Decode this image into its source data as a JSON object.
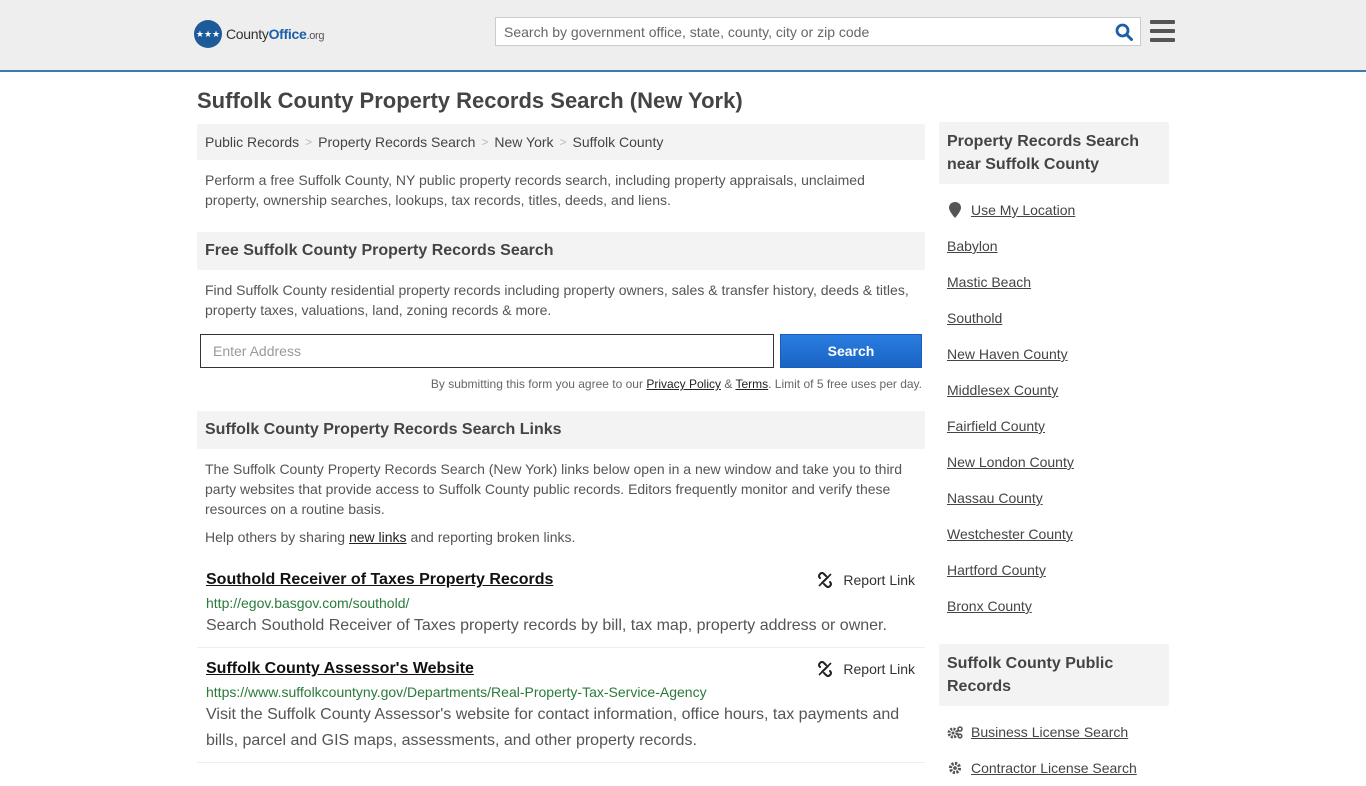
{
  "header": {
    "logo": {
      "name_part1": "County",
      "name_part2": "Office",
      "suffix": ".org"
    },
    "search_placeholder": "Search by government office, state, county, city or zip code",
    "brand_color": "#1d5a9a",
    "accent_border": "#3a7bb0"
  },
  "page_title": "Suffolk County Property Records Search (New York)",
  "breadcrumb": [
    {
      "label": "Public Records"
    },
    {
      "label": "Property Records Search"
    },
    {
      "label": "New York"
    },
    {
      "label": "Suffolk County"
    }
  ],
  "intro": "Perform a free Suffolk County, NY public property records search, including property appraisals, unclaimed property, ownership searches, lookups, tax records, titles, deeds, and liens.",
  "free_search": {
    "heading": "Free Suffolk County Property Records Search",
    "text": "Find Suffolk County residential property records including property owners, sales & transfer history, deeds & titles, property taxes, valuations, land, zoning records & more.",
    "input_placeholder": "Enter Address",
    "button_label": "Search",
    "disclaimer_pre": "By submitting this form you agree to our ",
    "privacy_label": "Privacy Policy",
    "amp": " & ",
    "terms_label": "Terms",
    "disclaimer_post": ". Limit of 5 free uses per day."
  },
  "links_section": {
    "heading": "Suffolk County Property Records Search Links",
    "text": "The Suffolk County Property Records Search (New York) links below open in a new window and take you to third party websites that provide access to Suffolk County public records. Editors frequently monitor and verify these resources on a routine basis.",
    "help_pre": "Help others by sharing ",
    "help_link": "new links",
    "help_post": " and reporting broken links.",
    "report_label": "Report Link",
    "items": [
      {
        "title": "Southold Receiver of Taxes Property Records",
        "url": "http://egov.basgov.com/southold/",
        "description": "Search Southold Receiver of Taxes property records by bill, tax map, property address or owner."
      },
      {
        "title": "Suffolk County Assessor's Website",
        "url": "https://www.suffolkcountyny.gov/Departments/Real-Property-Tax-Service-Agency",
        "description": "Visit the Suffolk County Assessor's website for contact information, office hours, tax payments and bills, parcel and GIS maps, assessments, and other property records."
      }
    ]
  },
  "sidebar": {
    "nearby_heading": "Property Records Search near Suffolk County",
    "use_location": "Use My Location",
    "nearby": [
      "Babylon",
      "Mastic Beach",
      "Southold",
      "New Haven County",
      "Middlesex County",
      "Fairfield County",
      "New London County",
      "Nassau County",
      "Westchester County",
      "Hartford County",
      "Bronx County"
    ],
    "public_heading": "Suffolk County Public Records",
    "public_items": [
      "Business License Search",
      "Contractor License Search"
    ]
  }
}
